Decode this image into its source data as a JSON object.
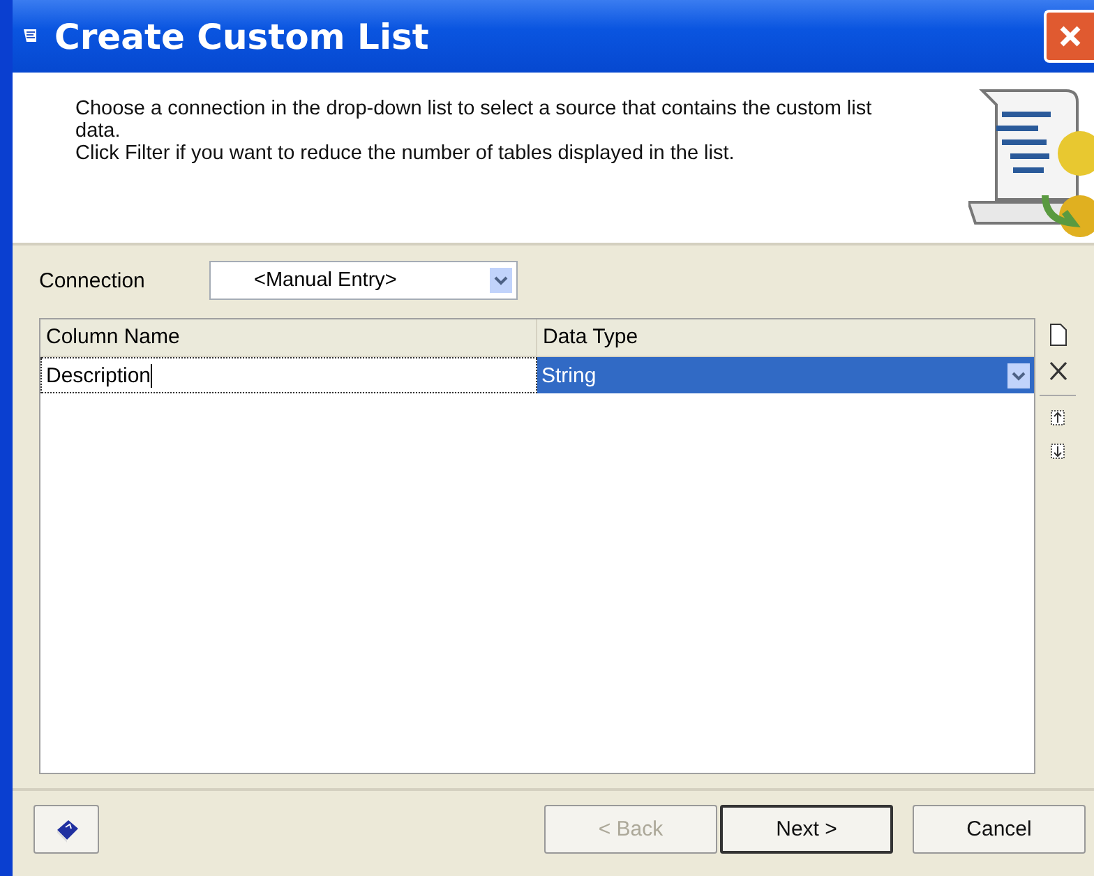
{
  "window": {
    "title": "Create Custom List"
  },
  "instructions": [
    "Choose a connection in the drop-down list to select a source that contains the custom list data.",
    "Click Filter if you want to reduce the number of tables displayed in the list."
  ],
  "connection": {
    "label": "Connection",
    "value": "<Manual Entry>"
  },
  "grid": {
    "columns": [
      "Column Name",
      "Data Type"
    ],
    "rows": [
      {
        "name": "Description",
        "data_type": "String",
        "selected": true
      }
    ]
  },
  "buttons": [
    {
      "label": "< Back",
      "disabled": true,
      "default": false
    },
    {
      "label": "Next >",
      "disabled": false,
      "default": true
    },
    {
      "label": "Cancel",
      "disabled": false,
      "default": false
    }
  ]
}
